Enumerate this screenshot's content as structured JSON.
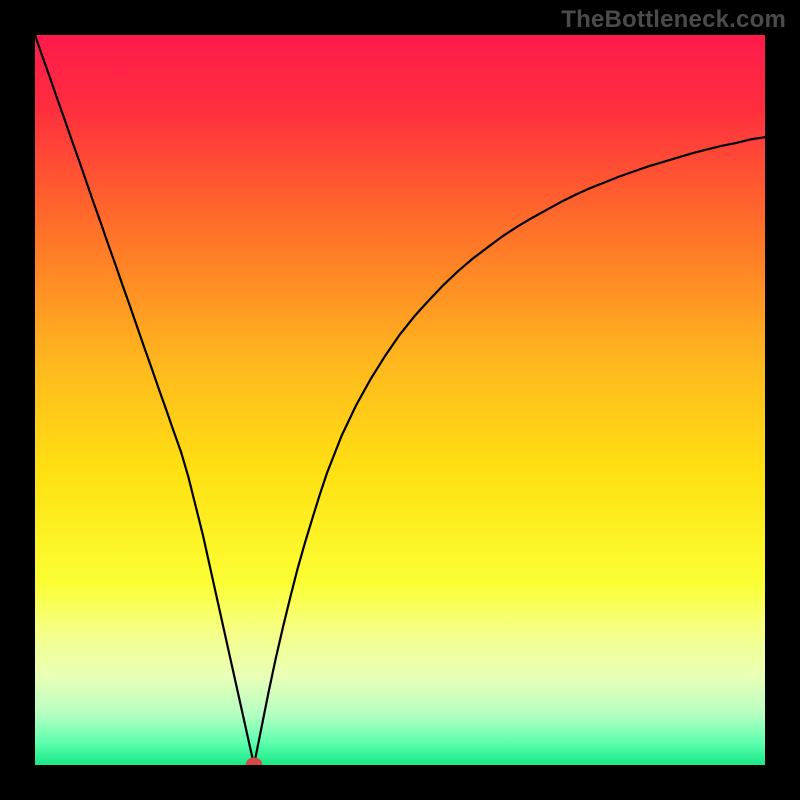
{
  "watermark": "TheBottleneck.com",
  "chart_data": {
    "type": "line",
    "title": "",
    "xlabel": "",
    "ylabel": "",
    "xlim": [
      0,
      100
    ],
    "ylim": [
      0,
      100
    ],
    "grid": false,
    "gradient_stops": [
      {
        "offset": 0,
        "color": "#ff1a4b"
      },
      {
        "offset": 10,
        "color": "#ff2e3f"
      },
      {
        "offset": 25,
        "color": "#ff6a2a"
      },
      {
        "offset": 45,
        "color": "#ffb81e"
      },
      {
        "offset": 60,
        "color": "#ffe112"
      },
      {
        "offset": 75,
        "color": "#fbff33"
      },
      {
        "offset": 82,
        "color": "#f6ff8a"
      },
      {
        "offset": 88,
        "color": "#e8ffb8"
      },
      {
        "offset": 93,
        "color": "#b6ffc2"
      },
      {
        "offset": 97,
        "color": "#5cffad"
      },
      {
        "offset": 100,
        "color": "#17e887"
      }
    ],
    "minimum_marker": {
      "x": 30.0,
      "y": 0.2,
      "color": "#d24a4a"
    },
    "series": [
      {
        "name": "bottleneck-curve",
        "color": "#000000",
        "x": [
          0,
          1,
          2,
          3,
          4,
          5,
          6,
          7,
          8,
          9,
          10,
          11,
          12,
          13,
          14,
          15,
          16,
          17,
          18,
          19,
          20,
          21,
          22,
          23,
          24,
          25,
          26,
          27,
          28,
          29,
          30,
          31,
          32,
          33,
          34,
          35,
          36,
          37,
          38,
          39,
          40,
          42,
          44,
          46,
          48,
          50,
          52,
          54,
          56,
          58,
          60,
          62,
          64,
          66,
          68,
          70,
          72,
          74,
          76,
          78,
          80,
          82,
          84,
          86,
          88,
          90,
          92,
          94,
          96,
          98,
          100
        ],
        "y": [
          100,
          97.1,
          94.3,
          91.4,
          88.6,
          85.7,
          82.9,
          80.0,
          77.1,
          74.3,
          71.4,
          68.6,
          65.7,
          62.9,
          60.0,
          57.1,
          54.3,
          51.4,
          48.6,
          45.7,
          42.9,
          39.5,
          35.5,
          31.5,
          27.0,
          22.5,
          18.0,
          13.5,
          9.0,
          4.5,
          0.0,
          5.0,
          10.0,
          14.7,
          19.0,
          23.1,
          27.0,
          30.5,
          33.8,
          37.0,
          40.0,
          45.1,
          49.3,
          52.9,
          56.1,
          59.0,
          61.5,
          63.7,
          65.8,
          67.7,
          69.4,
          70.9,
          72.4,
          73.7,
          74.9,
          76.0,
          77.1,
          78.1,
          79.0,
          79.8,
          80.6,
          81.3,
          82.0,
          82.6,
          83.2,
          83.8,
          84.3,
          84.8,
          85.2,
          85.7,
          86.0
        ]
      }
    ]
  }
}
